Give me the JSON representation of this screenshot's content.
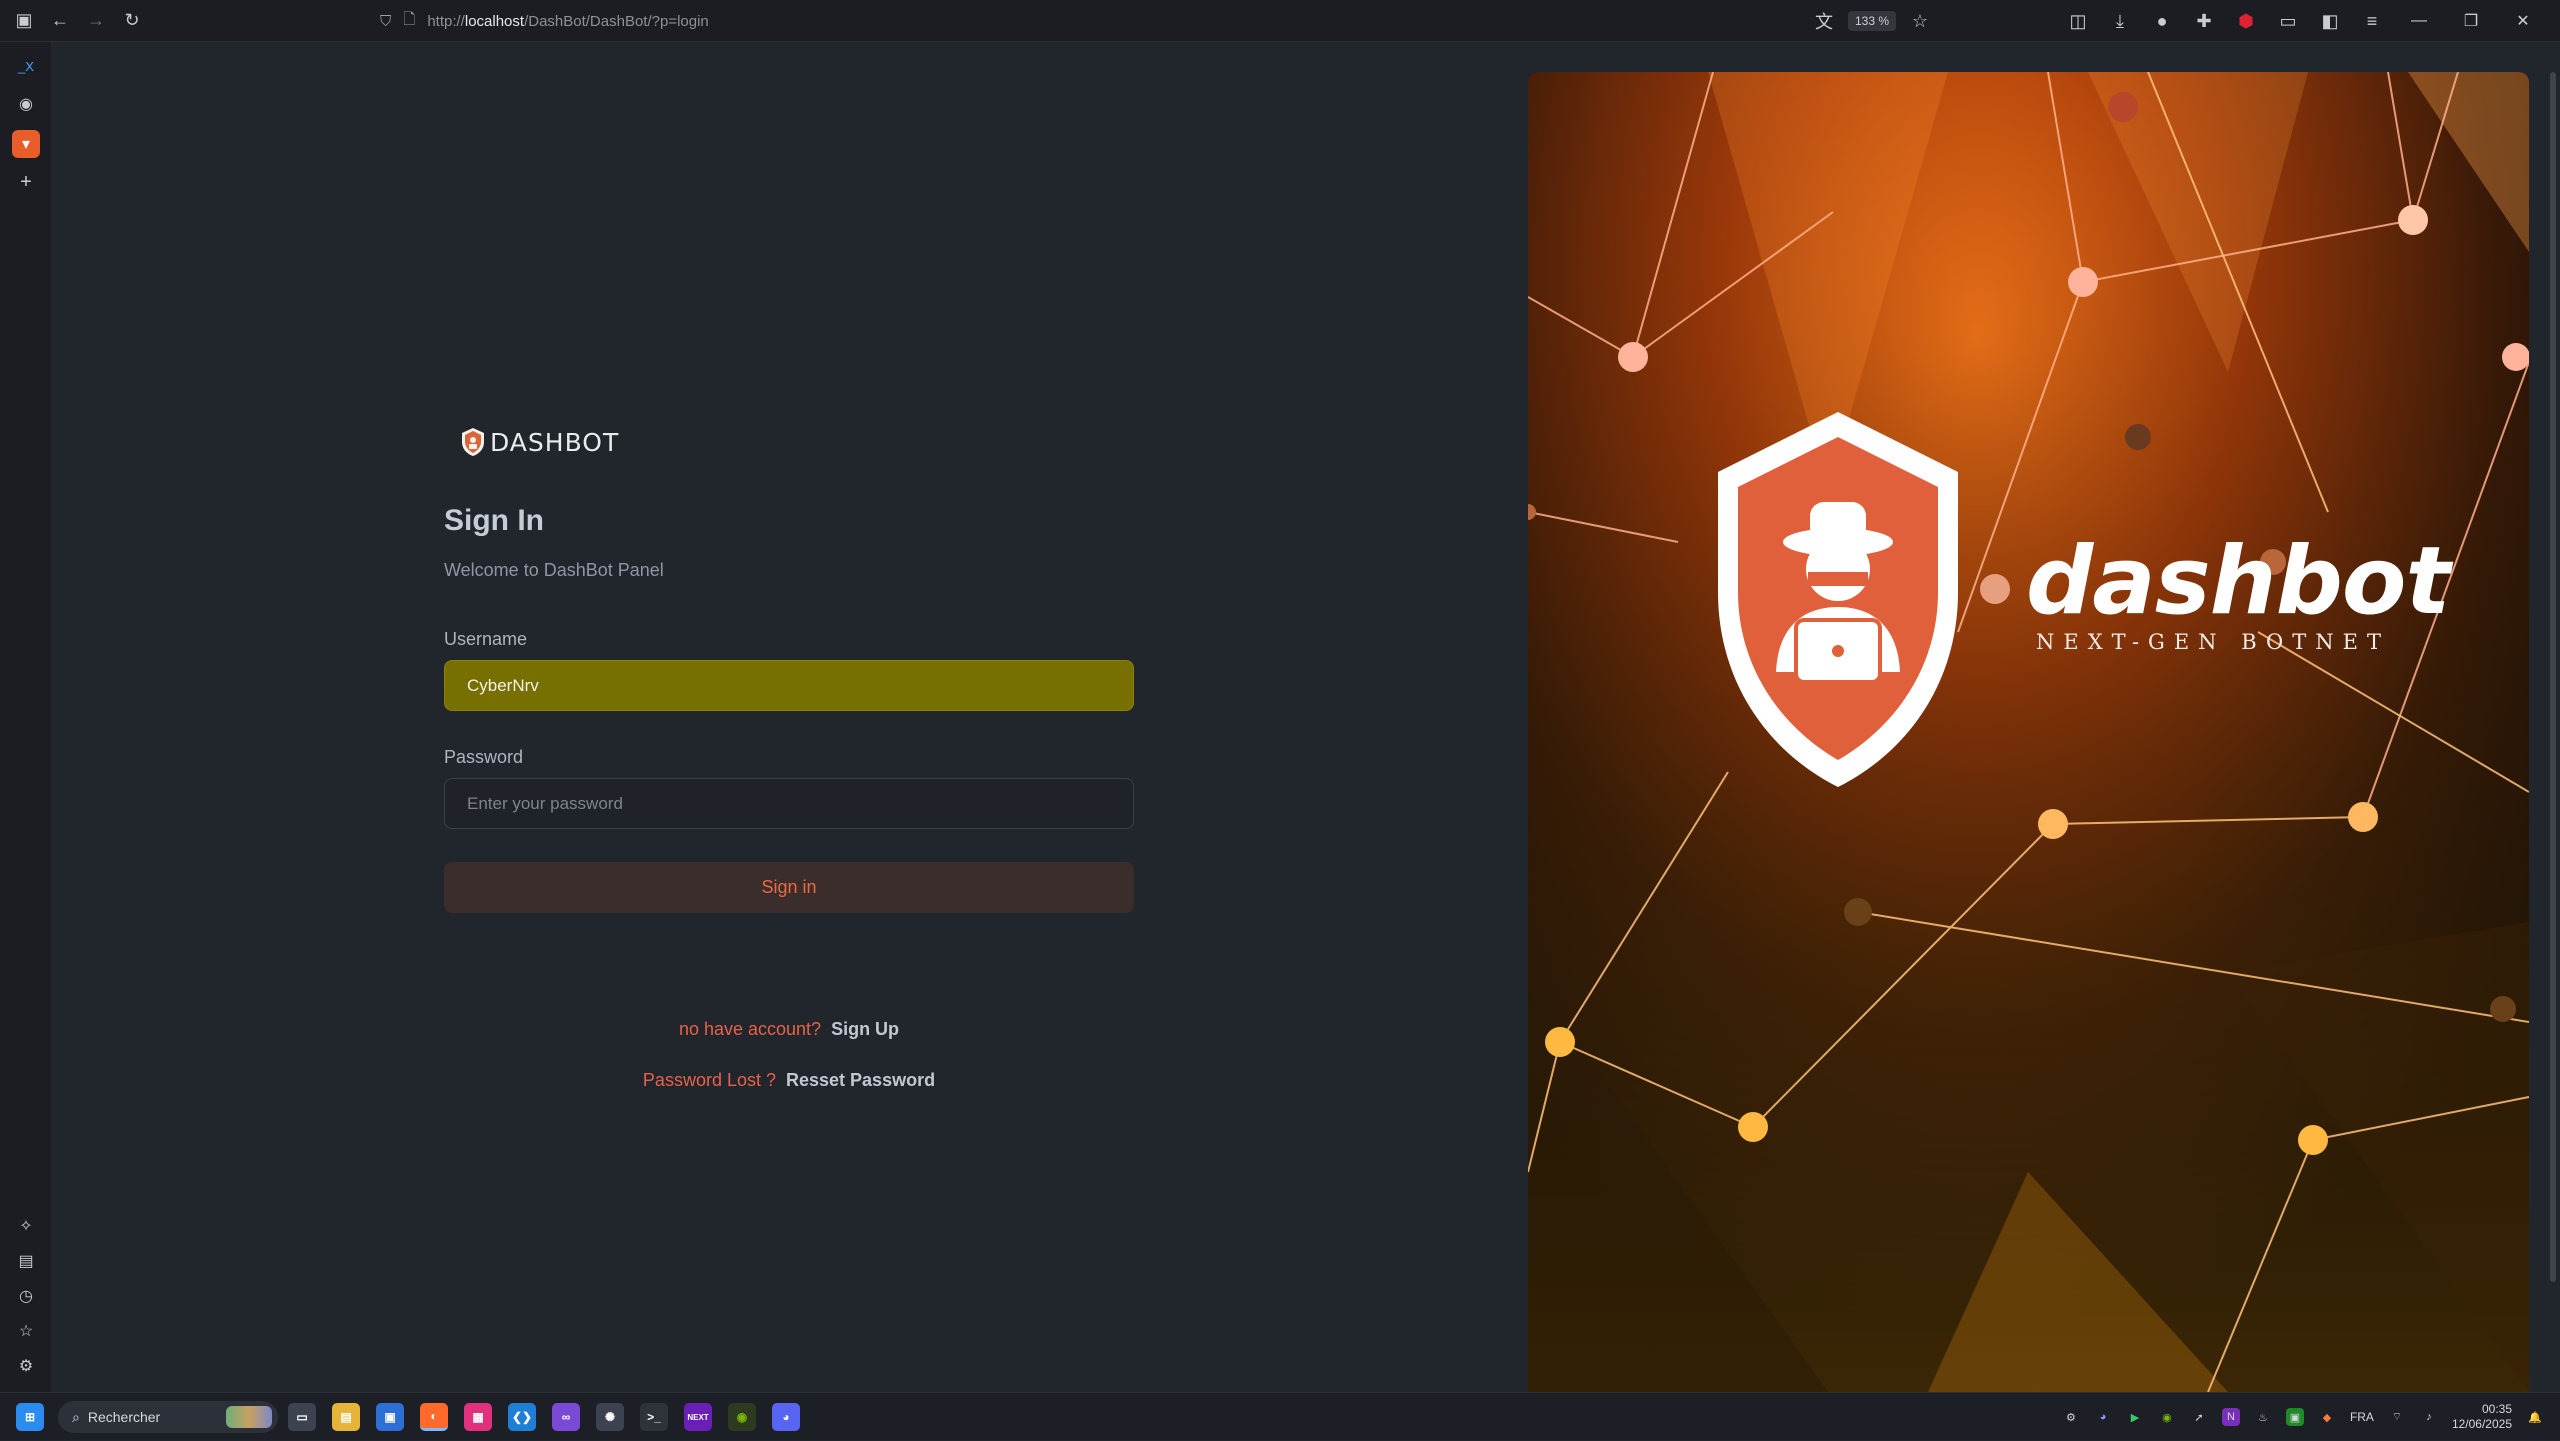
{
  "browser": {
    "url_prefix": "http://",
    "url_host": "localhost",
    "url_path": "/DashBot/DashBot/?p=login",
    "zoom": "133 %"
  },
  "login": {
    "brand": "DASHBOT",
    "title": "Sign In",
    "subtitle": "Welcome to DashBot Panel",
    "username_label": "Username",
    "username_value": "CyberNrv",
    "password_label": "Password",
    "password_placeholder": "Enter your password",
    "signin_label": "Sign in",
    "no_account": "no have account?",
    "signup": "Sign Up",
    "password_lost": "Password Lost ?",
    "reset": "Resset Password"
  },
  "hero": {
    "title": "dashbot",
    "subtitle": "NEXT-GEN BOTNET"
  },
  "taskbar": {
    "search_placeholder": "Rechercher",
    "language": "FRA",
    "time": "00:35",
    "date": "12/06/2025"
  },
  "colors": {
    "accent": "#e8624a",
    "username_fill": "#776f00",
    "page_bg": "#21252c"
  }
}
